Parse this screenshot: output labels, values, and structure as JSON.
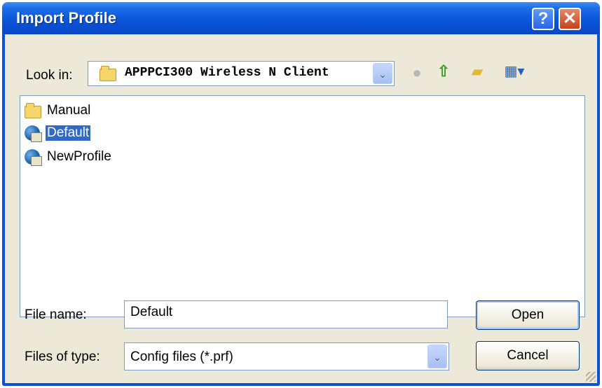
{
  "window": {
    "title": "Import Profile",
    "help_glyph": "?",
    "close_glyph": "✕"
  },
  "look_in": {
    "label": "Look in:",
    "value": "APPPCI300 Wireless N Client",
    "folder_icon": "folder-icon",
    "dropdown_glyph": "⌄"
  },
  "toolbar": {
    "back_icon": "back-icon",
    "up_icon": "up-folder-icon",
    "new_folder_icon": "new-folder-icon",
    "views_icon": "views-menu-icon",
    "back_glyph": "●",
    "up_glyph": "⇧",
    "new_folder_glyph": "▰",
    "views_glyph": "▦▾"
  },
  "files": [
    {
      "name": "Manual",
      "icon": "folder-icon",
      "selected": false
    },
    {
      "name": "Default",
      "icon": "profile-icon",
      "selected": true
    },
    {
      "name": "NewProfile",
      "icon": "profile-icon",
      "selected": false
    }
  ],
  "file_name": {
    "label": "File name:",
    "value": "Default"
  },
  "file_type": {
    "label": "Files of type:",
    "value": "Config files (*.prf)",
    "dropdown_glyph": "⌄"
  },
  "buttons": {
    "open": "Open",
    "cancel": "Cancel"
  },
  "colors": {
    "titlebar": "#0a55d9",
    "selection": "#316ac5",
    "dialog_bg": "#ece9d8"
  }
}
